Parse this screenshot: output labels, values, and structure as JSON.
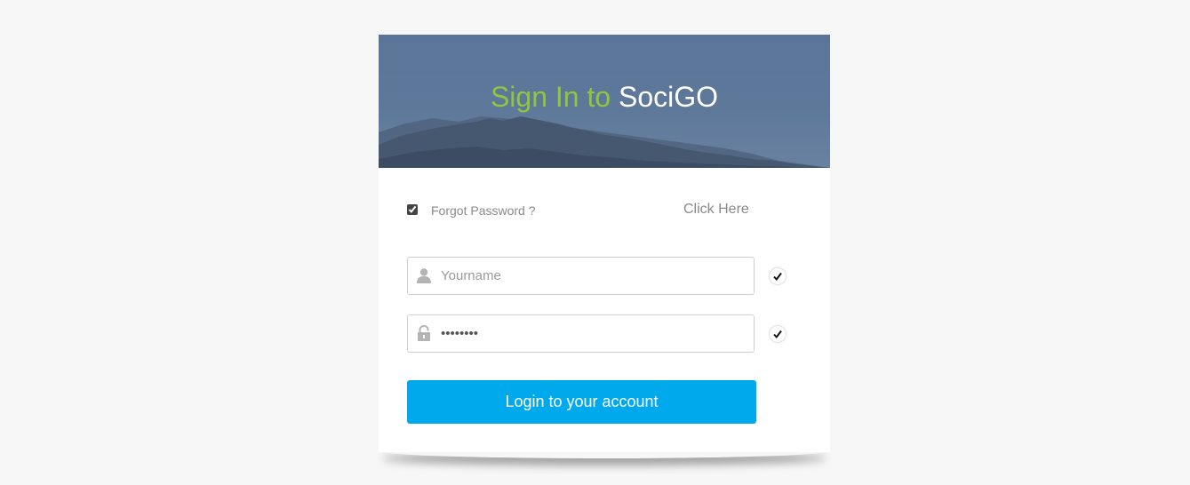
{
  "banner": {
    "title_prefix": "Sign In to",
    "title_brand": "SociGO"
  },
  "forgot": {
    "label": "Forgot Password ?",
    "link": "Click Here",
    "checked": true
  },
  "username": {
    "placeholder": "Yourname",
    "value": "",
    "icon": "user-icon",
    "valid": true
  },
  "password": {
    "placeholder": "",
    "value": "••••••••",
    "icon": "lock-icon",
    "valid": true
  },
  "login_button": {
    "label": "Login to your account"
  },
  "colors": {
    "background": "#f7f7f7",
    "title_green": "#8dc63f",
    "button_blue": "#00a8ec",
    "banner_blue": "#5e789a"
  }
}
